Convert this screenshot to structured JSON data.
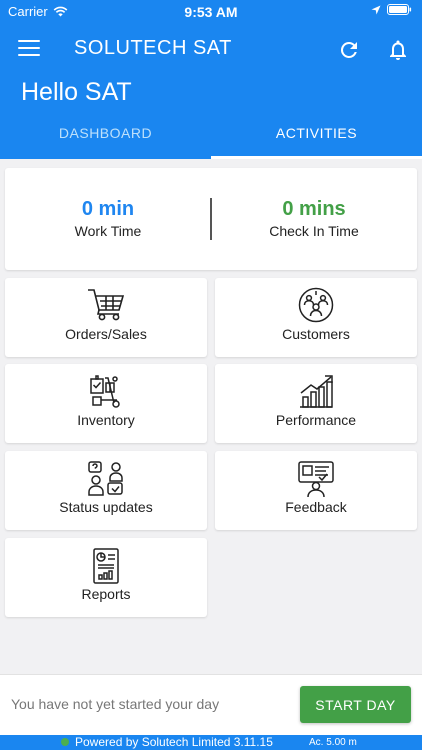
{
  "status_bar": {
    "carrier": "Carrier",
    "time": "9:53 AM"
  },
  "app": {
    "title": "SOLUTECH SAT",
    "greeting": "Hello SAT"
  },
  "tabs": [
    {
      "label": "DASHBOARD",
      "selected": false
    },
    {
      "label": "ACTIVITIES",
      "selected": true
    }
  ],
  "summary": {
    "work_time": {
      "value": "0 min",
      "label": "Work Time"
    },
    "check_in_time": {
      "value": "0 mins",
      "label": "Check In Time"
    }
  },
  "tiles": [
    {
      "label": "Orders/Sales",
      "icon": "shopping-cart-icon"
    },
    {
      "label": "Customers",
      "icon": "customers-icon"
    },
    {
      "label": "Inventory",
      "icon": "inventory-icon"
    },
    {
      "label": "Performance",
      "icon": "performance-chart-icon"
    },
    {
      "label": "Status updates",
      "icon": "status-updates-icon"
    },
    {
      "label": "Feedback",
      "icon": "feedback-icon"
    },
    {
      "label": "Reports",
      "icon": "reports-icon"
    }
  ],
  "bottom": {
    "day_status": "You have not yet started your day",
    "start_button": "START DAY"
  },
  "footer": {
    "powered_by": "Powered by Solutech Limited 3.11.15",
    "accuracy": "Ac. 5.00 m"
  },
  "colors": {
    "primary": "#1a86f0",
    "work_time": "#1f86f0",
    "check_in": "#43a047",
    "start_button": "#43a047",
    "background": "#f1f1f3"
  }
}
